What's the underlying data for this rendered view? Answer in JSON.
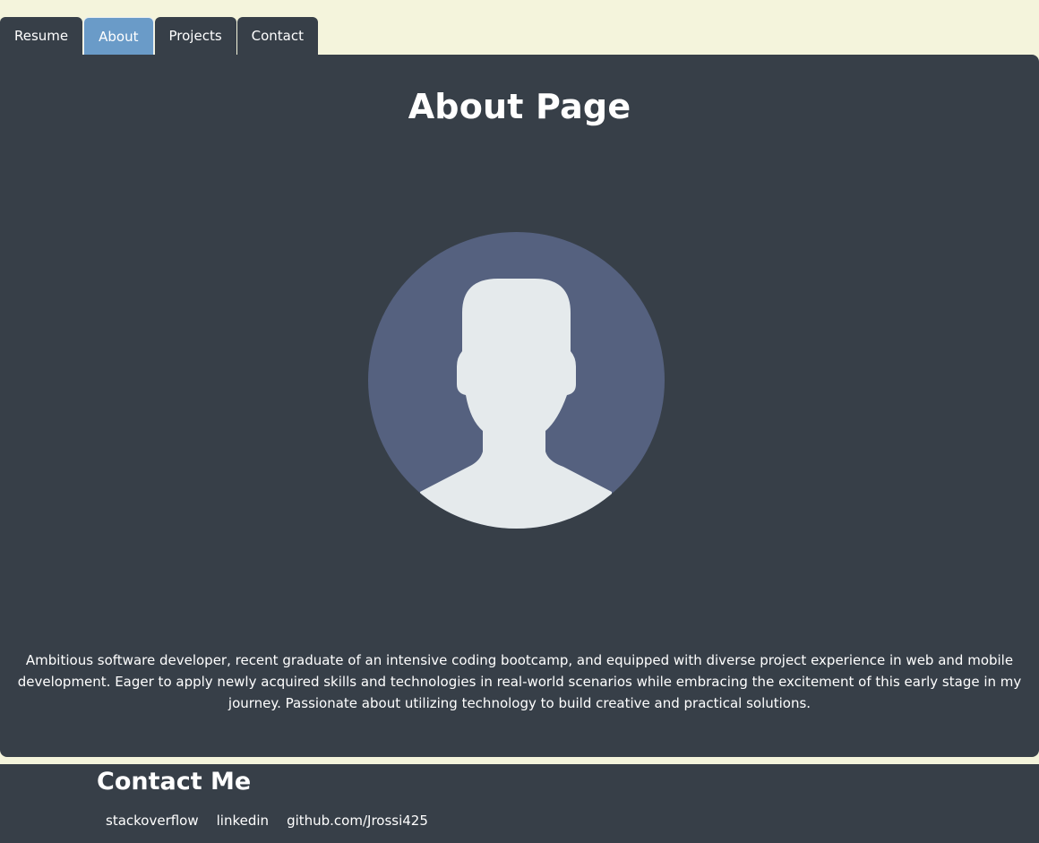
{
  "nav": {
    "tabs": [
      {
        "label": "Resume",
        "active": false
      },
      {
        "label": "About",
        "active": true
      },
      {
        "label": "Projects",
        "active": false
      },
      {
        "label": "Contact",
        "active": false
      }
    ]
  },
  "main": {
    "title": "About Page",
    "avatar_icon": "user-silhouette-icon",
    "bio": "Ambitious software developer, recent graduate of an intensive coding bootcamp, and equipped with diverse project experience in web and mobile development. Eager to apply newly acquired skills and technologies in real-world scenarios while embracing the excitement of this early stage in my journey. Passionate about utilizing technology to build creative and practical solutions."
  },
  "footer": {
    "title": "Contact Me",
    "links": [
      "stackoverflow",
      "linkedin",
      "github.com/Jrossi425"
    ]
  },
  "colors": {
    "page_background": "#f4f4dc",
    "panel": "#373f48",
    "active_tab": "#6a9bc8",
    "avatar_circle": "#55617f",
    "avatar_figure": "#e5eaec"
  }
}
